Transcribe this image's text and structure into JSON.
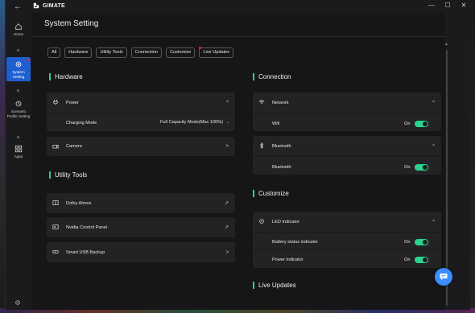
{
  "app": {
    "brand": "GIMATE",
    "back_glyph": "←",
    "min_glyph": "—",
    "max_glyph": "☐",
    "close_glyph": "✕"
  },
  "sidebar": {
    "items": [
      {
        "label": "Home",
        "icon": "home-icon"
      },
      {
        "label": "System Setting",
        "icon": "settings-icon",
        "active": true
      },
      {
        "label": "Scenario Profile Setting",
        "icon": "scenario-icon"
      },
      {
        "label": "Apps",
        "icon": "apps-icon"
      }
    ]
  },
  "page": {
    "title": "System Setting"
  },
  "chips": [
    "All",
    "Hardware",
    "Utility Tools",
    "Connection",
    "Customize",
    "Live Updates"
  ],
  "hardware": {
    "title": "Hardware",
    "power": {
      "label": "Power",
      "chev": "^",
      "charging_mode_label": "Charging Mode",
      "charging_mode_value": "Full Capacity Mode(Max 100%)",
      "arrow": "⌄"
    },
    "camera": {
      "label": "Camera",
      "chev": ">"
    }
  },
  "utility": {
    "title": "Utility Tools",
    "items": [
      {
        "label": "Dolby Atmos",
        "icon": "dolby-icon",
        "action": "↗"
      },
      {
        "label": "Nvidia Control Panel",
        "icon": "nvidia-icon",
        "action": "↗"
      },
      {
        "label": "Smart USB Backup",
        "icon": "usb-icon",
        "action": ">"
      }
    ]
  },
  "connection": {
    "title": "Connection",
    "network": {
      "label": "Network",
      "chev": "^",
      "wifi_label": "Wifi",
      "wifi_state": "On",
      "wifi_on": true
    },
    "bluetooth": {
      "label": "Bluetooth",
      "chev": "^",
      "bt_label": "Bluetooth",
      "bt_state": "On",
      "bt_on": true
    }
  },
  "customize": {
    "title": "Customize",
    "led": {
      "label": "LED Indicator",
      "chev": "^",
      "battery_label": "Battery status indicator",
      "battery_state": "On",
      "power_label": "Power indicator",
      "power_state": "On"
    }
  },
  "live_updates": {
    "title": "Live Updates"
  },
  "colors": {
    "accent": "#2bd18f",
    "active_nav": "#1f5fd0",
    "badge": "#e22233"
  }
}
